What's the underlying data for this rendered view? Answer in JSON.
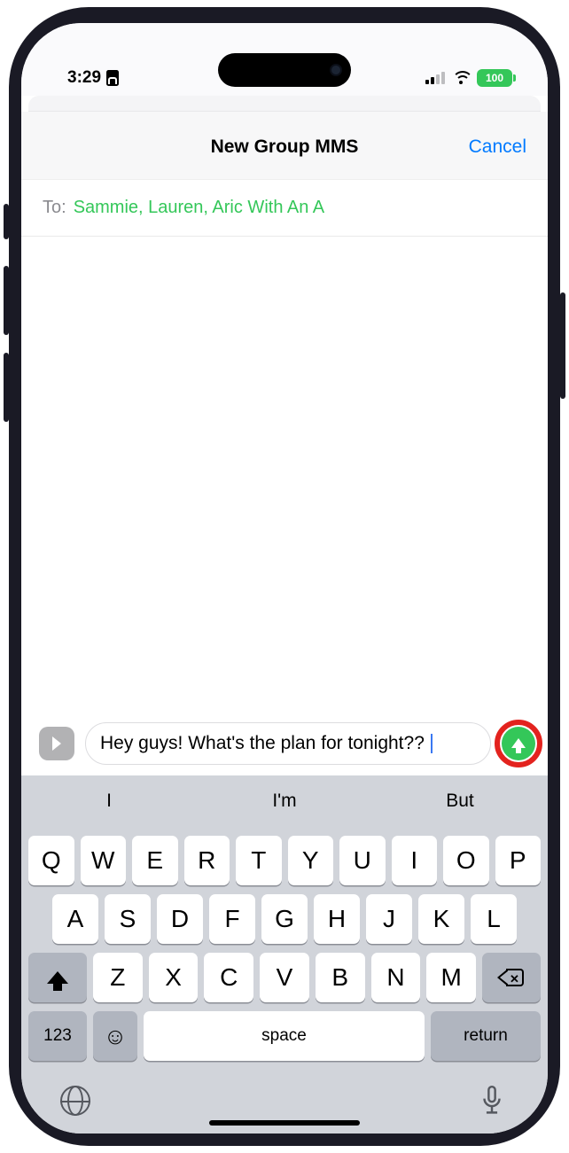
{
  "status": {
    "time": "3:29",
    "battery": "100"
  },
  "header": {
    "title": "New Group MMS",
    "cancel": "Cancel"
  },
  "to": {
    "label": "To:",
    "recipients": "Sammie, Lauren, Aric With An A"
  },
  "compose": {
    "text": "Hey guys! What's the plan for tonight?? "
  },
  "predict": [
    "I",
    "I'm",
    "But"
  ],
  "keys": {
    "row1": [
      "Q",
      "W",
      "E",
      "R",
      "T",
      "Y",
      "U",
      "I",
      "O",
      "P"
    ],
    "row2": [
      "A",
      "S",
      "D",
      "F",
      "G",
      "H",
      "J",
      "K",
      "L"
    ],
    "row3": [
      "Z",
      "X",
      "C",
      "V",
      "B",
      "N",
      "M"
    ],
    "num": "123",
    "space": "space",
    "ret": "return"
  }
}
